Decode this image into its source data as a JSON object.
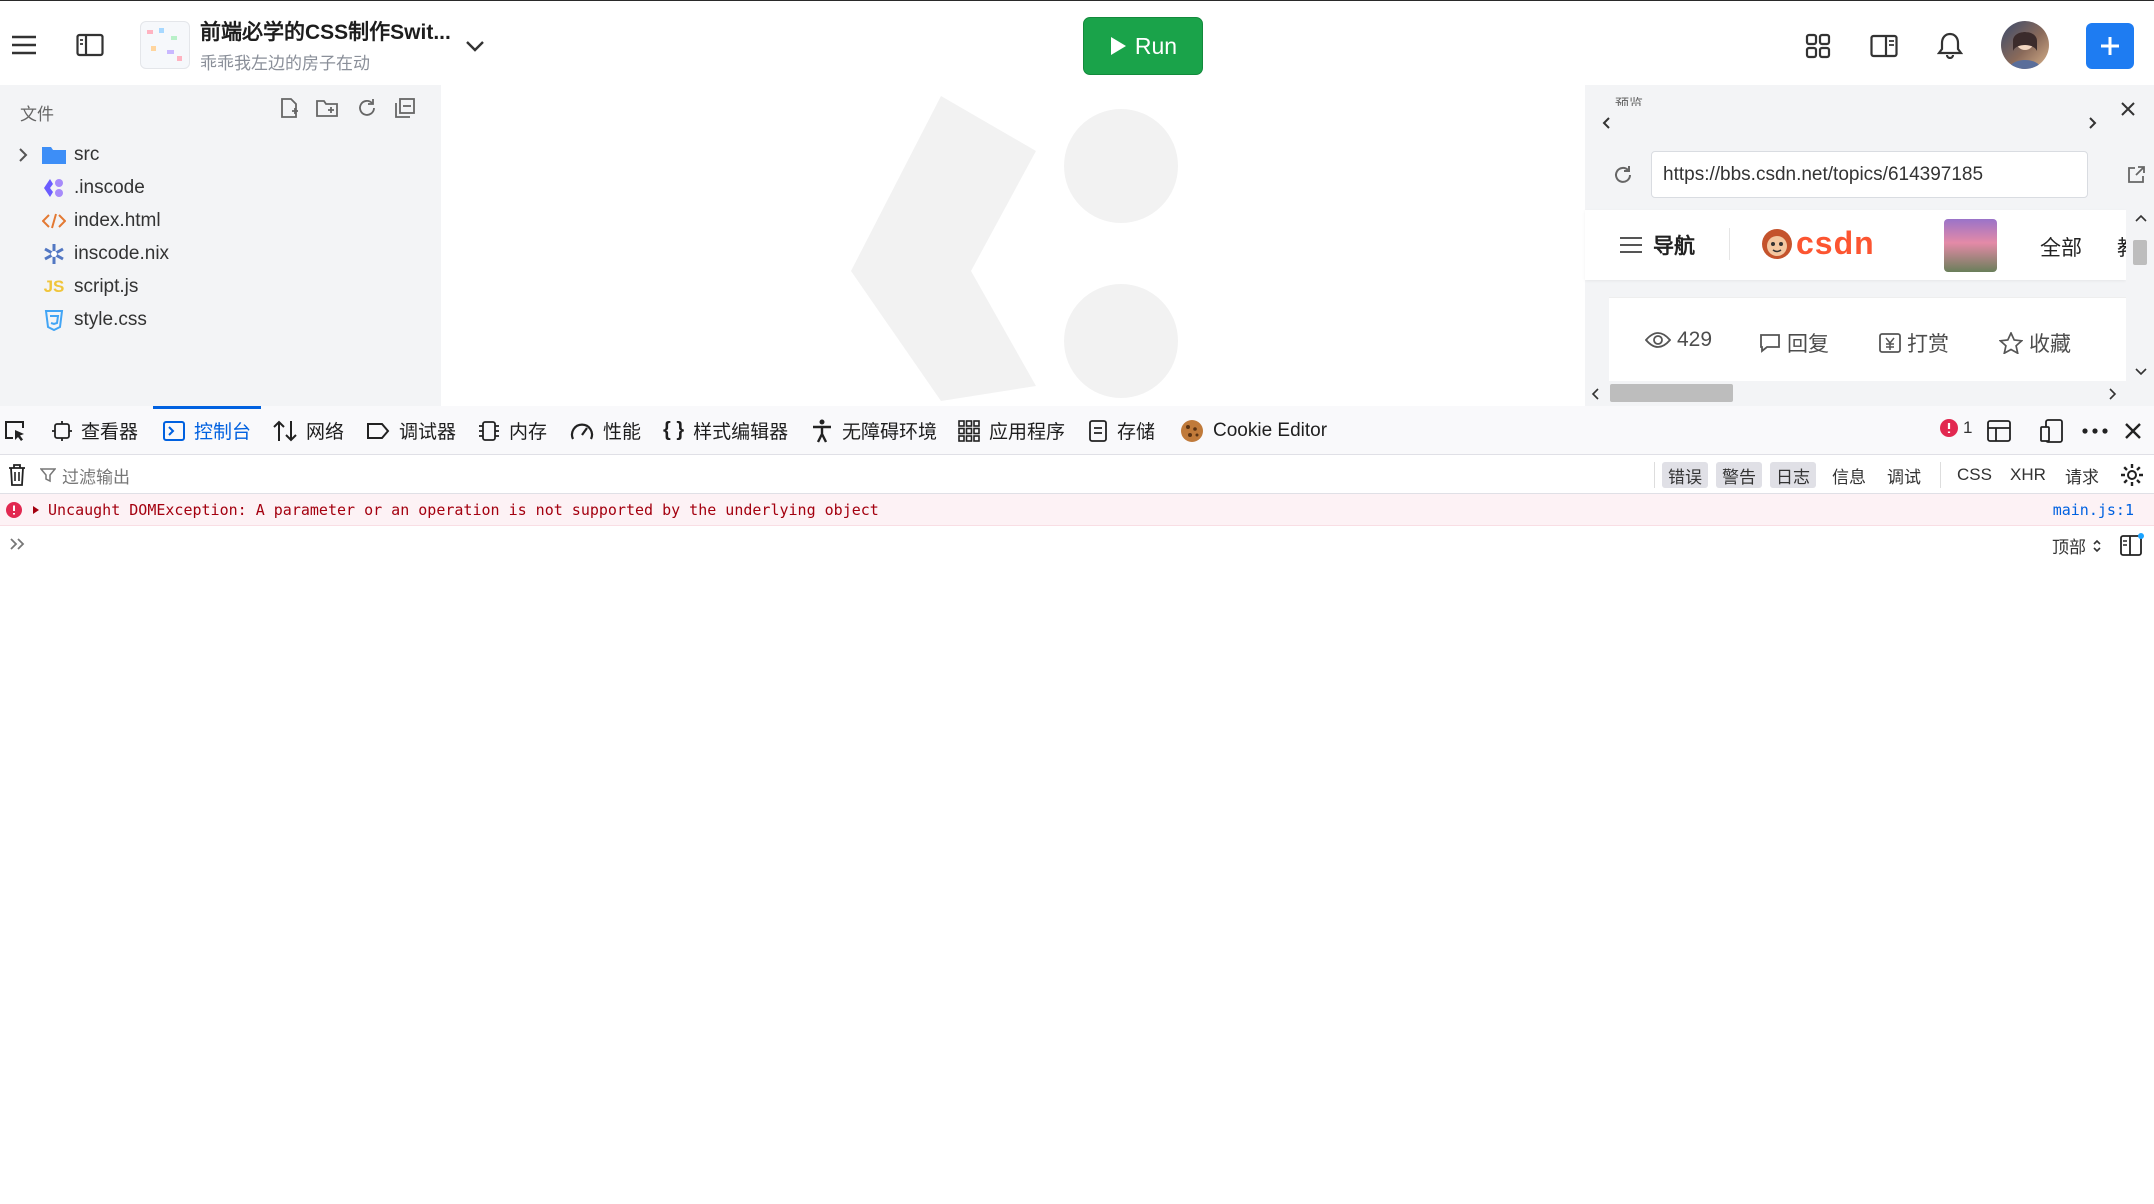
{
  "topbar": {
    "project_title": "前端必学的CSS制作Swit...",
    "project_subtitle": "乖乖我左边的房子在动",
    "run_label": "Run"
  },
  "sidebar": {
    "label": "文件",
    "items": [
      {
        "name": "src",
        "icon": "folder-icon"
      },
      {
        "name": ".inscode",
        "icon": "inscode-icon"
      },
      {
        "name": "index.html",
        "icon": "html-icon"
      },
      {
        "name": "inscode.nix",
        "icon": "nix-icon"
      },
      {
        "name": "script.js",
        "icon": "js-icon"
      },
      {
        "name": "style.css",
        "icon": "css-icon"
      }
    ]
  },
  "preview": {
    "label": "预览",
    "url": "https://bbs.csdn.net/topics/614397185",
    "nav_label": "导航",
    "brand": "CSDN",
    "all_label": "全部",
    "cut_char": "教",
    "stats": {
      "views": "429",
      "reply": "回复",
      "tip": "打赏",
      "fav": "收藏"
    }
  },
  "devtools": {
    "tabs": [
      "查看器",
      "控制台",
      "网络",
      "调试器",
      "内存",
      "性能",
      "样式编辑器",
      "无障碍环境",
      "应用程序",
      "存储",
      "Cookie Editor"
    ],
    "active_tab": "控制台",
    "error_count": "1",
    "filter_placeholder": "过滤输出",
    "filters": [
      "错误",
      "警告",
      "日志",
      "信息",
      "调试",
      "CSS",
      "XHR",
      "请求"
    ],
    "error_message": "Uncaught DOMException: A parameter or an operation is not supported by the underlying object",
    "error_source": "main.js:1",
    "context_label": "顶部"
  },
  "colors": {
    "run_green": "#1aa34a",
    "accent_blue": "#0061e0",
    "error_red": "#a4000f",
    "csdn_red": "#fc5531"
  }
}
